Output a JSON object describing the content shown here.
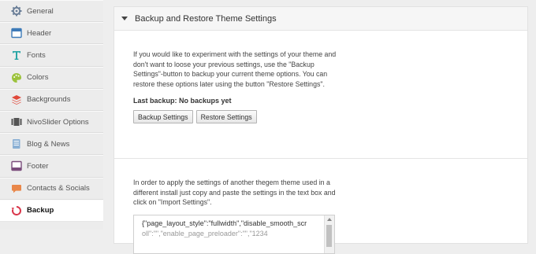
{
  "sidebar": {
    "items": [
      {
        "label": "General",
        "icon": "gear-icon",
        "active": false
      },
      {
        "label": "Header",
        "icon": "header-icon",
        "active": false
      },
      {
        "label": "Fonts",
        "icon": "font-icon",
        "active": false
      },
      {
        "label": "Colors",
        "icon": "palette-icon",
        "active": false
      },
      {
        "label": "Backgrounds",
        "icon": "layers-icon",
        "active": false
      },
      {
        "label": "NivoSlider Options",
        "icon": "slider-icon",
        "active": false
      },
      {
        "label": "Blog & News",
        "icon": "document-icon",
        "active": false
      },
      {
        "label": "Footer",
        "icon": "footer-icon",
        "active": false
      },
      {
        "label": "Contacts & Socials",
        "icon": "speech-bubble-icon",
        "active": false
      },
      {
        "label": "Backup",
        "icon": "backup-icon",
        "active": true
      }
    ]
  },
  "panel": {
    "title": "Backup and Restore Theme Settings",
    "backup_section": {
      "description": "If you would like to experiment with the settings of your theme and don't want to loose your previous settings, use the \"Backup Settings\"-button to backup your current theme options. You can restore these options later using the button \"Restore Settings\".",
      "last_backup": "Last backup: No backups yet",
      "backup_button": "Backup Settings",
      "restore_button": "Restore Settings"
    },
    "import_section": {
      "description": "In order to apply the settings of another thegem theme used in a different install just copy and paste the settings in the text box and click on \"Import Settings\".",
      "settings_text": "{\"page_layout_style\":\"fullwidth\",\"disable_smooth_scr",
      "settings_text_line2": "oll\":\"\",\"enable_page_preloader\":\"\",\"1234"
    }
  },
  "colors": {
    "sidebar_bg": "#ececec",
    "active_bg": "#ffffff",
    "panel_bg": "#ffffff",
    "header_bg": "#f6f6f6"
  }
}
